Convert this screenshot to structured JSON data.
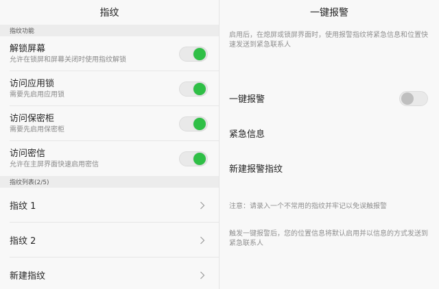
{
  "left": {
    "title": "指纹",
    "section_functions": "指纹功能",
    "functions": [
      {
        "title": "解锁屏幕",
        "subtitle": "允许在锁屏和屏幕关闭时使用指纹解锁",
        "enabled": true
      },
      {
        "title": "访问应用锁",
        "subtitle": "需要先启用应用锁",
        "enabled": true
      },
      {
        "title": "访问保密柜",
        "subtitle": "需要先启用保密柜",
        "enabled": true
      },
      {
        "title": "访问密信",
        "subtitle": "允许在主屏界面快速启用密信",
        "enabled": true
      }
    ],
    "section_list": "指纹列表(2/5)",
    "fingerprints": [
      {
        "label": "指纹 1"
      },
      {
        "label": "指纹 2"
      },
      {
        "label": "新建指纹"
      }
    ]
  },
  "right": {
    "title": "一键报警",
    "description": "启用后，在熄屏或锁屏界面时，使用报警指纹将紧急信息和位置快速发送到紧急联系人",
    "alarm_toggle_label": "一键报警",
    "alarm_enabled": false,
    "emergency_info_label": "紧急信息",
    "new_alarm_fingerprint_label": "新建报警指纹",
    "note_1": "注意：请录入一个不常用的指纹并牢记以免误触报警",
    "note_2": "触发一键报警后，您的位置信息将默认启用并以信息的方式发送到紧急联系人"
  },
  "colors": {
    "toggle_on": "#2fbf46",
    "toggle_off": "#bfbfbf"
  }
}
